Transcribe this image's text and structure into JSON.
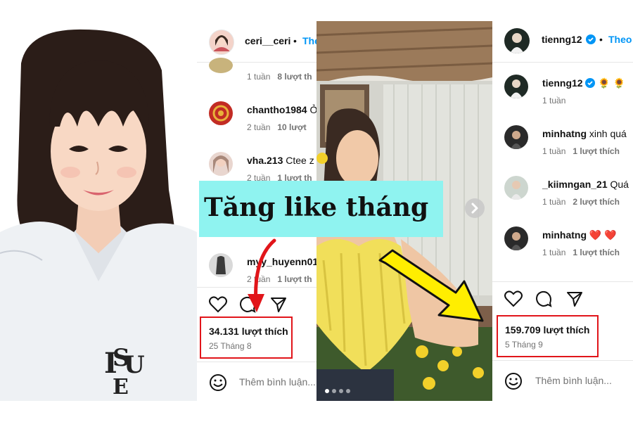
{
  "banner": {
    "text": "Tăng like tháng"
  },
  "post1": {
    "header": {
      "username": "ceri__ceri",
      "separator": "•",
      "follow": "Theo"
    },
    "comments": [
      {
        "user": "",
        "text": "",
        "time": "1 tuần",
        "likes": "8 lượt th"
      },
      {
        "user": "chantho1984",
        "text": "Ở",
        "time": "2 tuần",
        "likes": "10 lượt"
      },
      {
        "user": "vha.213",
        "text": "Ctee z",
        "time": "2 tuần",
        "likes": "1 lượt th"
      },
      {
        "user": "myy_huyenn01",
        "text": "",
        "time": "2 tuần",
        "likes": "1 lượt th"
      }
    ],
    "likes_text": "34.131 lượt thích",
    "date": "25 Tháng 8",
    "add_comment_placeholder": "Thêm bình luận..."
  },
  "post2": {
    "header": {
      "username": "tienng12",
      "separator": "•",
      "follow": "Theo"
    },
    "caption": {
      "user": "tienng12",
      "text": "🌻 🌻",
      "time": "1 tuần"
    },
    "comments": [
      {
        "user": "minhatng",
        "text": "xinh quá",
        "time": "1 tuần",
        "likes": "1 lượt thích"
      },
      {
        "user": "_kiimngan_21",
        "text": "Quá",
        "time": "1 tuần",
        "likes": "2 lượt thích"
      },
      {
        "user": "minhatng",
        "text": "❤️ ❤️",
        "time": "1 tuần",
        "likes": "1 lượt thích"
      }
    ],
    "likes_text": "159.709 lượt thích",
    "date": "5 Tháng 9",
    "add_comment_placeholder": "Thêm bình luận..."
  },
  "colors": {
    "highlight_box": "#e1151a",
    "banner_bg": "#8ff3f0",
    "arrow_yellow": "#ffee00",
    "follow_blue": "#0095f6",
    "verified": "#0095f6"
  },
  "icons": [
    "heart-icon",
    "comment-icon",
    "share-icon",
    "emoji-icon",
    "verified-badge-icon",
    "chevron-right-icon"
  ]
}
